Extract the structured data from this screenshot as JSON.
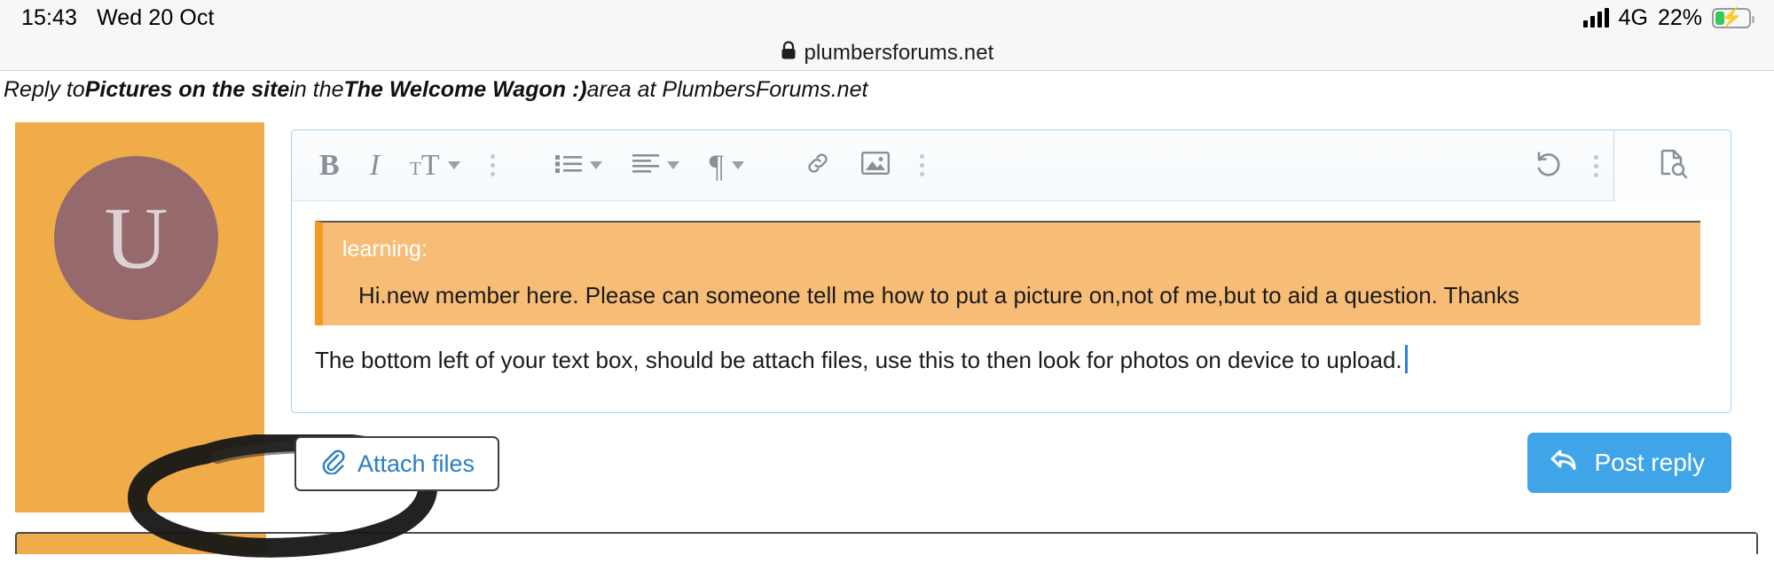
{
  "status_bar": {
    "time": "15:43",
    "date": "Wed 20 Oct",
    "network": "4G",
    "battery_percent": "22%",
    "battery_charging": true,
    "signal_bars": 4,
    "battery_fill_color": "#34c759"
  },
  "browser": {
    "lock_icon": "lock-icon",
    "url": "plumbersforums.net"
  },
  "breadcrumb": {
    "prefix": "Reply to ",
    "thread_title": "Pictures on the site",
    "middle": " in the ",
    "forum_name": "The Welcome Wagon :)",
    "suffix": " area at PlumbersForums.net"
  },
  "post": {
    "avatar_initial": "U",
    "avatar_background": "#96696d",
    "sidebar_color": "#efac49"
  },
  "toolbar": {
    "bold": "B",
    "italic": "I",
    "font_size_small": "T",
    "font_size_large": "T",
    "paragraph": "¶",
    "items": [
      "bold-icon",
      "italic-icon",
      "font-size-icon",
      "more-text-icon",
      "bullet-list-icon",
      "align-icon",
      "paragraph-icon",
      "link-icon",
      "image-icon",
      "more-insert-icon"
    ],
    "right_items": [
      "undo-icon",
      "more-options-icon",
      "preview-icon"
    ]
  },
  "editor": {
    "quote_author": "learning:",
    "quote_text": "Hi.new member here.  Please can someone tell me how to put a picture on,not of me,but to aid a question.  Thanks",
    "body_text": "The bottom left of your text box, should be attach files, use this to then look for photos on device to upload.",
    "quote_background": "#f7bd77",
    "quote_bar_color": "#f39a22"
  },
  "actions": {
    "attach_label": "Attach files",
    "attach_icon": "paperclip-icon",
    "post_label": "Post reply",
    "post_icon": "reply-arrow-icon",
    "post_button_color": "#3fa5e8"
  },
  "annotation": {
    "type": "hand-drawn-circle",
    "color": "#161616",
    "target": "attach-files-button"
  }
}
